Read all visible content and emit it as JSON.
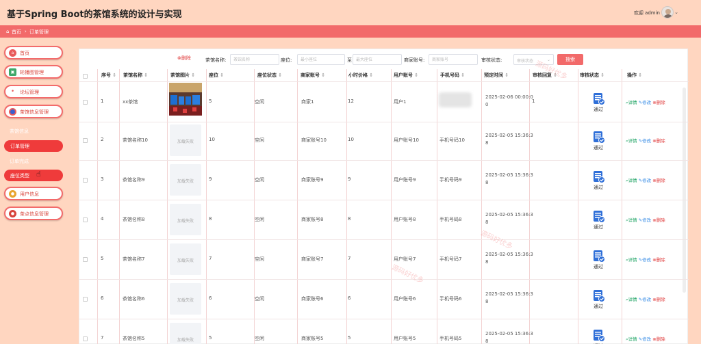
{
  "header": {
    "title": "基于Spring Boot的茶馆系统的设计与实现",
    "welcome": "欢迎 admin",
    "dropdown_icon": "chevron-down-icon"
  },
  "breadcrumb": {
    "home": "首页",
    "separator": "›",
    "current": "订单管理"
  },
  "sidebar": {
    "items": [
      {
        "label": "首页",
        "icon": "home-icon",
        "color": "#e85c5c"
      },
      {
        "label": "轮播图管理",
        "icon": "image-icon",
        "color": "#3fa86a"
      },
      {
        "label": "论坛管理",
        "icon": "dot-icon",
        "color": "#e85c5c"
      },
      {
        "label": "茶馆信息管理",
        "icon": "store-icon",
        "color": "#3a5fcf"
      }
    ],
    "sub_items": [
      "茶馆信息",
      "订单管理",
      "订单完成",
      "座位类型"
    ],
    "items2": [
      {
        "label": "用户信息",
        "icon": "user-icon",
        "color": "#e8a630"
      },
      {
        "label": "茶点信息管理",
        "icon": "food-icon",
        "color": "#d8453c"
      }
    ]
  },
  "search": {
    "delete_label": "删除",
    "name_label": "茶馆名称:",
    "name_placeholder": "茶馆名称",
    "seat_label": "座位:",
    "seat_min_placeholder": "最小座位",
    "range_sep": "至",
    "seat_max_placeholder": "最大座位",
    "merchant_label": "商家账号:",
    "merchant_placeholder": "商家账号",
    "audit_label": "审核状态:",
    "audit_placeholder": "审核状态",
    "search_button": "搜索"
  },
  "table": {
    "columns": [
      "序号",
      "茶馆名称",
      "茶馆图片",
      "座位",
      "座位状态",
      "商家账号",
      "小时价格",
      "用户账号",
      "手机号码",
      "预定时间",
      "审核回复",
      "审核状态",
      "操作"
    ],
    "sort_icon": "sort-icon",
    "image_fail": "加载失败",
    "status_text": "通过",
    "ops": {
      "detail": "详情",
      "edit": "修改",
      "delete": "删除"
    },
    "rows": [
      {
        "no": "1",
        "name": "xx茶馆",
        "seat": "5",
        "seat_status": "空闲",
        "merchant": "商家1",
        "price": "12",
        "user": "用户1",
        "phone": "",
        "time1": "2025-02-06 00:00:0",
        "time2": "0",
        "reply": "1"
      },
      {
        "no": "2",
        "name": "茶馆名称10",
        "seat": "10",
        "seat_status": "空闲",
        "merchant": "商家账号10",
        "price": "10",
        "user": "用户账号10",
        "phone": "手机号码10",
        "time1": "2025-02-05 15:36:3",
        "time2": "8",
        "reply": ""
      },
      {
        "no": "3",
        "name": "茶馆名称9",
        "seat": "9",
        "seat_status": "空闲",
        "merchant": "商家账号9",
        "price": "9",
        "user": "用户账号9",
        "phone": "手机号码9",
        "time1": "2025-02-05 15:36:3",
        "time2": "8",
        "reply": ""
      },
      {
        "no": "4",
        "name": "茶馆名称8",
        "seat": "8",
        "seat_status": "空闲",
        "merchant": "商家账号8",
        "price": "8",
        "user": "用户账号8",
        "phone": "手机号码8",
        "time1": "2025-02-05 15:36:3",
        "time2": "8",
        "reply": ""
      },
      {
        "no": "5",
        "name": "茶馆名称7",
        "seat": "7",
        "seat_status": "空闲",
        "merchant": "商家账号7",
        "price": "7",
        "user": "用户账号7",
        "phone": "手机号码7",
        "time1": "2025-02-05 15:36:3",
        "time2": "8",
        "reply": ""
      },
      {
        "no": "6",
        "name": "茶馆名称6",
        "seat": "6",
        "seat_status": "空闲",
        "merchant": "商家账号6",
        "price": "6",
        "user": "用户账号6",
        "phone": "手机号码6",
        "time1": "2025-02-05 15:36:3",
        "time2": "8",
        "reply": ""
      },
      {
        "no": "7",
        "name": "茶馆名称5",
        "seat": "5",
        "seat_status": "空闲",
        "merchant": "商家账号5",
        "price": "5",
        "user": "用户账号5",
        "phone": "手机号码5",
        "time1": "2025-02-05 15:36:3",
        "time2": "8",
        "reply": ""
      }
    ]
  },
  "watermark": "源码好优多",
  "colors": {
    "brand": "#f26a6a",
    "page_bg": "#ffd6c0",
    "active": "#ef3b3b"
  }
}
